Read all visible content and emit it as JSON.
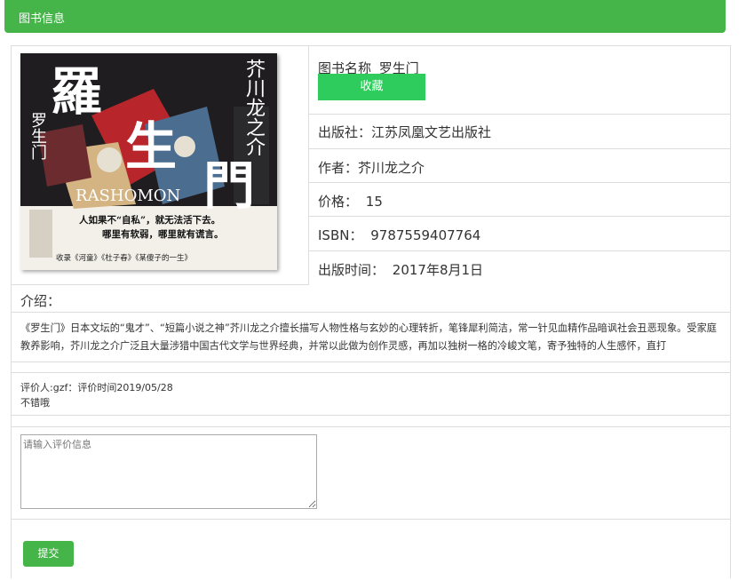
{
  "header": {
    "title": "图书信息"
  },
  "book": {
    "cover_text": {
      "title_chars": [
        "羅",
        "生",
        "門"
      ],
      "author_vertical": "芥川龙之介",
      "left_vertical": "罗生门",
      "english": "RASHOMON",
      "tagline_1": "人如果不“自私”，就无法活下去。",
      "tagline_2": "哪里有软弱，哪里就有谎言。",
      "bottom_line": "收录《河童》《杜子春》《某傻子的一生》"
    },
    "name_label": "图书名称",
    "name": "罗生门",
    "favorite_label": "收藏",
    "publisher_label": "出版社：",
    "publisher": "江苏凤凰文艺出版社",
    "author_label": "作者：",
    "author": "芥川龙之介",
    "price_label": "价格：",
    "price": "15",
    "isbn_label": "ISBN：",
    "isbn": "9787559407764",
    "pubdate_label": "出版时间：",
    "pubdate": "2017年8月1日"
  },
  "intro": {
    "heading": "介绍：",
    "line_1": "《罗生门》日本文坛的“鬼才”、“短篇小说之神”芥川龙之介擅长描写人物性格与玄妙的心理转折，笔锋犀利简洁，常一针见血精作品暗讽社会丑恶现象。受家庭",
    "line_2": "教养影响，芥川龙之介广泛且大量涉猎中国古代文学与世界经典，并常以此做为创作灵感，再加以独树一格的冷峻文笔，寄予独特的人生感怀，直打"
  },
  "review": {
    "meta": "评价人:gzf：评价时间2019/05/28",
    "content": "不错哦"
  },
  "form": {
    "placeholder": "请输入评价信息",
    "submit_label": "提交"
  }
}
